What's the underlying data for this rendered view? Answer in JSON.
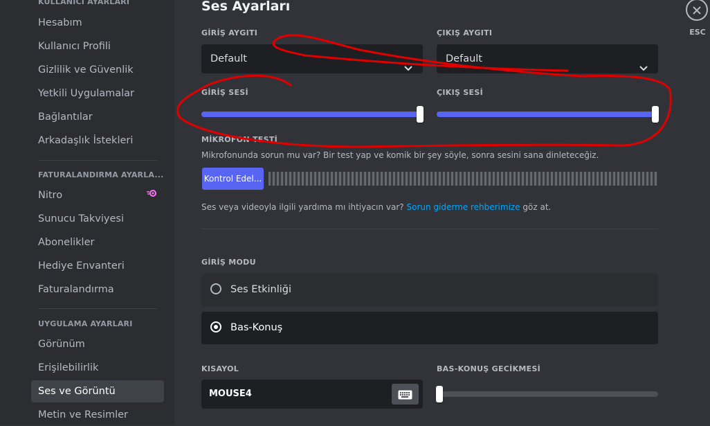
{
  "sidebar": {
    "headings": {
      "user_settings": "KULLANICI AYARLARI",
      "billing_settings": "FATURALANDIRMA AYARLA...",
      "app_settings": "UYGULAMA AYARLARI"
    },
    "user_items": [
      "Hesabım",
      "Kullanıcı Profili",
      "Gizlilik ve Güvenlik",
      "Yetkili Uygulamalar",
      "Bağlantılar",
      "Arkadaşlık İstekleri"
    ],
    "billing_items": [
      "Nitro",
      "Sunucu Takviyesi",
      "Abonelikler",
      "Hediye Envanteri",
      "Faturalandırma"
    ],
    "app_items": [
      "Görünüm",
      "Erişilebilirlik",
      "Ses ve Görüntü",
      "Metin ve Resimler"
    ],
    "active_item": "Ses ve Görüntü"
  },
  "main": {
    "title": "Ses Ayarları",
    "input_device": {
      "label": "GİRİŞ AYGITI",
      "value": "Default"
    },
    "output_device": {
      "label": "ÇIKIŞ AYGITI",
      "value": "Default"
    },
    "input_volume": {
      "label": "GİRİŞ SESİ",
      "level": 1.0
    },
    "output_volume": {
      "label": "ÇIKIŞ SESİ",
      "level": 1.0
    },
    "mic_test": {
      "label": "MİKROFON TESTİ",
      "description": "Mikrofonunda sorun mu var? Bir test yap ve komik bir şey söyle, sonra sesini sana dinleteceğiz.",
      "button": "Kontrol Edel..."
    },
    "help": {
      "prefix": "Ses veya videoyla ilgili yardıma mı ihtiyacın var? ",
      "link": "Sorun giderme rehberimize",
      "suffix": " göz at."
    },
    "input_mode": {
      "label": "GİRİŞ MODU",
      "options": [
        "Ses Etkinliği",
        "Bas-Konuş"
      ],
      "selected": "Bas-Konuş"
    },
    "shortcut": {
      "label": "KISAYOL",
      "value": "MOUSE4"
    },
    "ptt_delay": {
      "label": "BAS-KONUŞ GECİKMESİ",
      "level": 0.0
    },
    "close": {
      "label": "ESC"
    }
  },
  "colors": {
    "accent": "#5865f2",
    "link": "#00a8fc",
    "annotation": "#e00000",
    "nitro": "#ff73fa"
  },
  "icons": [
    "chevron-down-icon",
    "keyboard-icon",
    "close-icon",
    "nitro-icon"
  ]
}
